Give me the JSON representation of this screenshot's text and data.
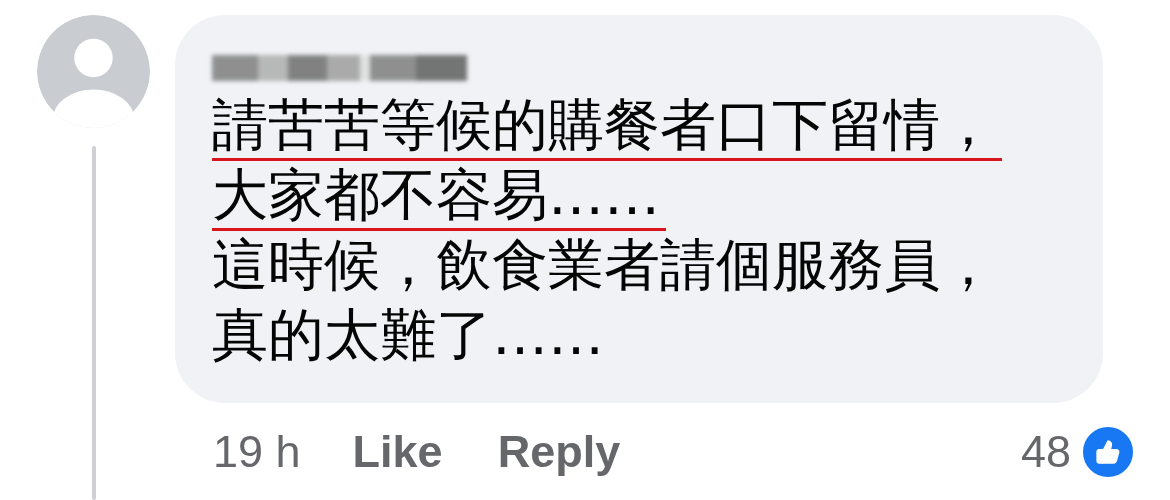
{
  "comment": {
    "author_obscured": true,
    "lines": [
      {
        "text": "請苦苦等候的購餐者口下留情，",
        "underlined": true
      },
      {
        "text": "大家都不容易……",
        "underlined": true
      },
      {
        "text": "這時候，飲食業者請個服務員，",
        "underlined": false
      },
      {
        "text": "真的太難了……",
        "underlined": false
      }
    ],
    "time": "19 h",
    "actions": [
      "Like",
      "Reply"
    ],
    "reaction_count": "48"
  }
}
